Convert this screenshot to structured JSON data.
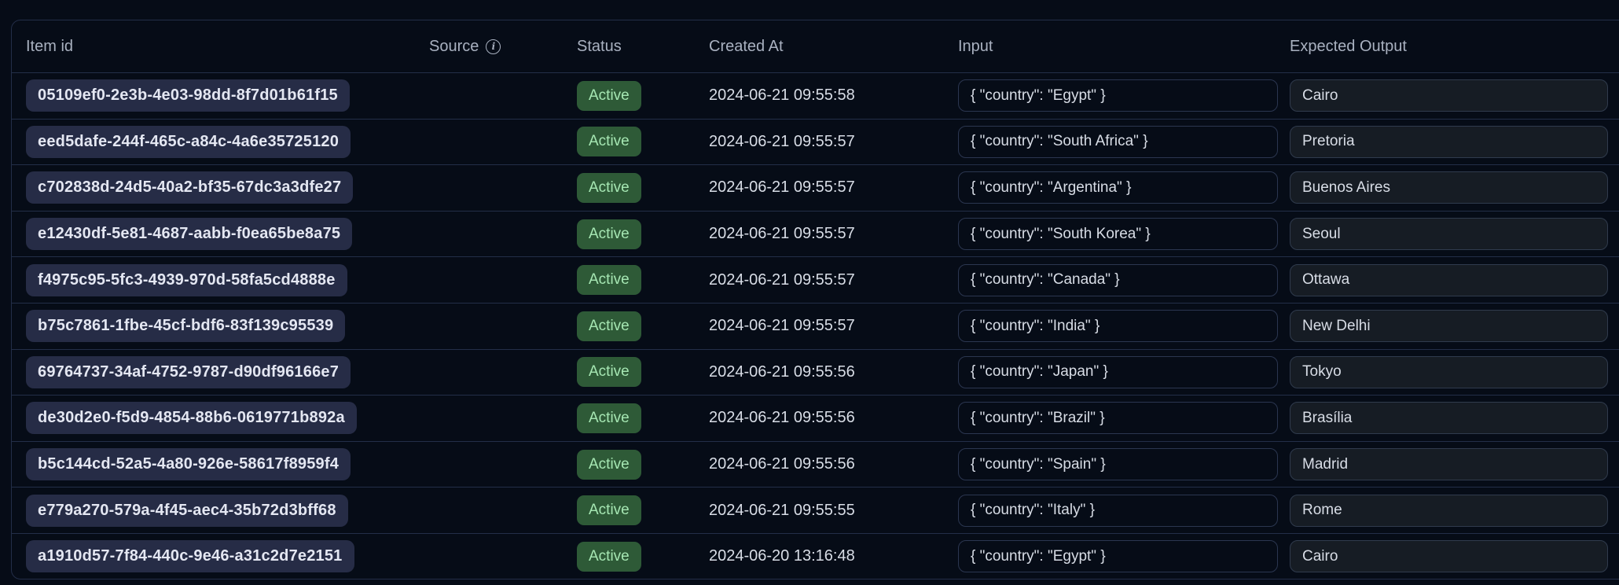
{
  "table": {
    "columns": [
      {
        "key": "item_id",
        "label": "Item id"
      },
      {
        "key": "source",
        "label": "Source",
        "info_icon": "info-circle"
      },
      {
        "key": "status",
        "label": "Status"
      },
      {
        "key": "created_at",
        "label": "Created At"
      },
      {
        "key": "input",
        "label": "Input"
      },
      {
        "key": "expected_output",
        "label": "Expected Output"
      }
    ],
    "rows": [
      {
        "item_id": "05109ef0-2e3b-4e03-98dd-8f7d01b61f15",
        "status": "Active",
        "created_at": "2024-06-21 09:55:58",
        "input": "{ \"country\": \"Egypt\" }",
        "expected_output": "Cairo"
      },
      {
        "item_id": "eed5dafe-244f-465c-a84c-4a6e35725120",
        "status": "Active",
        "created_at": "2024-06-21 09:55:57",
        "input": "{ \"country\": \"South Africa\" }",
        "expected_output": "Pretoria"
      },
      {
        "item_id": "c702838d-24d5-40a2-bf35-67dc3a3dfe27",
        "status": "Active",
        "created_at": "2024-06-21 09:55:57",
        "input": "{ \"country\": \"Argentina\" }",
        "expected_output": "Buenos Aires"
      },
      {
        "item_id": "e12430df-5e81-4687-aabb-f0ea65be8a75",
        "status": "Active",
        "created_at": "2024-06-21 09:55:57",
        "input": "{ \"country\": \"South Korea\" }",
        "expected_output": "Seoul"
      },
      {
        "item_id": "f4975c95-5fc3-4939-970d-58fa5cd4888e",
        "status": "Active",
        "created_at": "2024-06-21 09:55:57",
        "input": "{ \"country\": \"Canada\" }",
        "expected_output": "Ottawa"
      },
      {
        "item_id": "b75c7861-1fbe-45cf-bdf6-83f139c95539",
        "status": "Active",
        "created_at": "2024-06-21 09:55:57",
        "input": "{ \"country\": \"India\" }",
        "expected_output": "New Delhi"
      },
      {
        "item_id": "69764737-34af-4752-9787-d90df96166e7",
        "status": "Active",
        "created_at": "2024-06-21 09:55:56",
        "input": "{ \"country\": \"Japan\" }",
        "expected_output": "Tokyo"
      },
      {
        "item_id": "de30d2e0-f5d9-4854-88b6-0619771b892a",
        "status": "Active",
        "created_at": "2024-06-21 09:55:56",
        "input": "{ \"country\": \"Brazil\" }",
        "expected_output": "Brasília"
      },
      {
        "item_id": "b5c144cd-52a5-4a80-926e-58617f8959f4",
        "status": "Active",
        "created_at": "2024-06-21 09:55:56",
        "input": "{ \"country\": \"Spain\" }",
        "expected_output": "Madrid"
      },
      {
        "item_id": "e779a270-579a-4f45-aec4-35b72d3bff68",
        "status": "Active",
        "created_at": "2024-06-21 09:55:55",
        "input": "{ \"country\": \"Italy\" }",
        "expected_output": "Rome"
      },
      {
        "item_id": "a1910d57-7f84-440c-9e46-a31c2d7e2151",
        "status": "Active",
        "created_at": "2024-06-20 13:16:48",
        "input": "{ \"country\": \"Egypt\" }",
        "expected_output": "Cairo"
      }
    ]
  },
  "colors": {
    "page_bg": "#060c17",
    "grid_line": "#232e48",
    "status_active_bg": "#2e5a37",
    "status_active_text": "#a6e7b3",
    "item_id_pill_bg": "#262c46"
  }
}
